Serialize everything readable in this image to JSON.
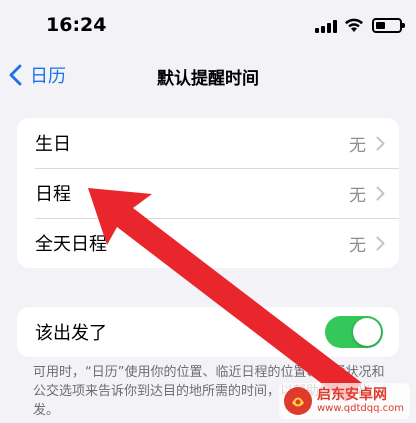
{
  "status_bar": {
    "time": "16:24"
  },
  "nav": {
    "back_label": "日历",
    "title": "默认提醒时间"
  },
  "reminders": {
    "rows": [
      {
        "label": "生日",
        "value": "无"
      },
      {
        "label": "日程",
        "value": "无"
      },
      {
        "label": "全天日程",
        "value": "无"
      }
    ]
  },
  "time_to_leave": {
    "label": "该出发了",
    "enabled": true,
    "footnote": "可用时，“日历”使用你的位置、临近日程的位置、交通状况和公交选项来告诉你到达目的地所需的时间，以帮助你准时出发。"
  },
  "watermark": {
    "name": "启东安卓网",
    "url": "www.qdtdqq.com"
  },
  "colors": {
    "accent": "#1a73e8",
    "toggle_on": "#34c759",
    "arrow": "#e8262b"
  },
  "icons": [
    "cellular-signal-icon",
    "wifi-icon",
    "battery-icon",
    "chevron-left-icon",
    "chevron-right-icon",
    "red-arrow-icon",
    "watermark-logo-icon"
  ]
}
